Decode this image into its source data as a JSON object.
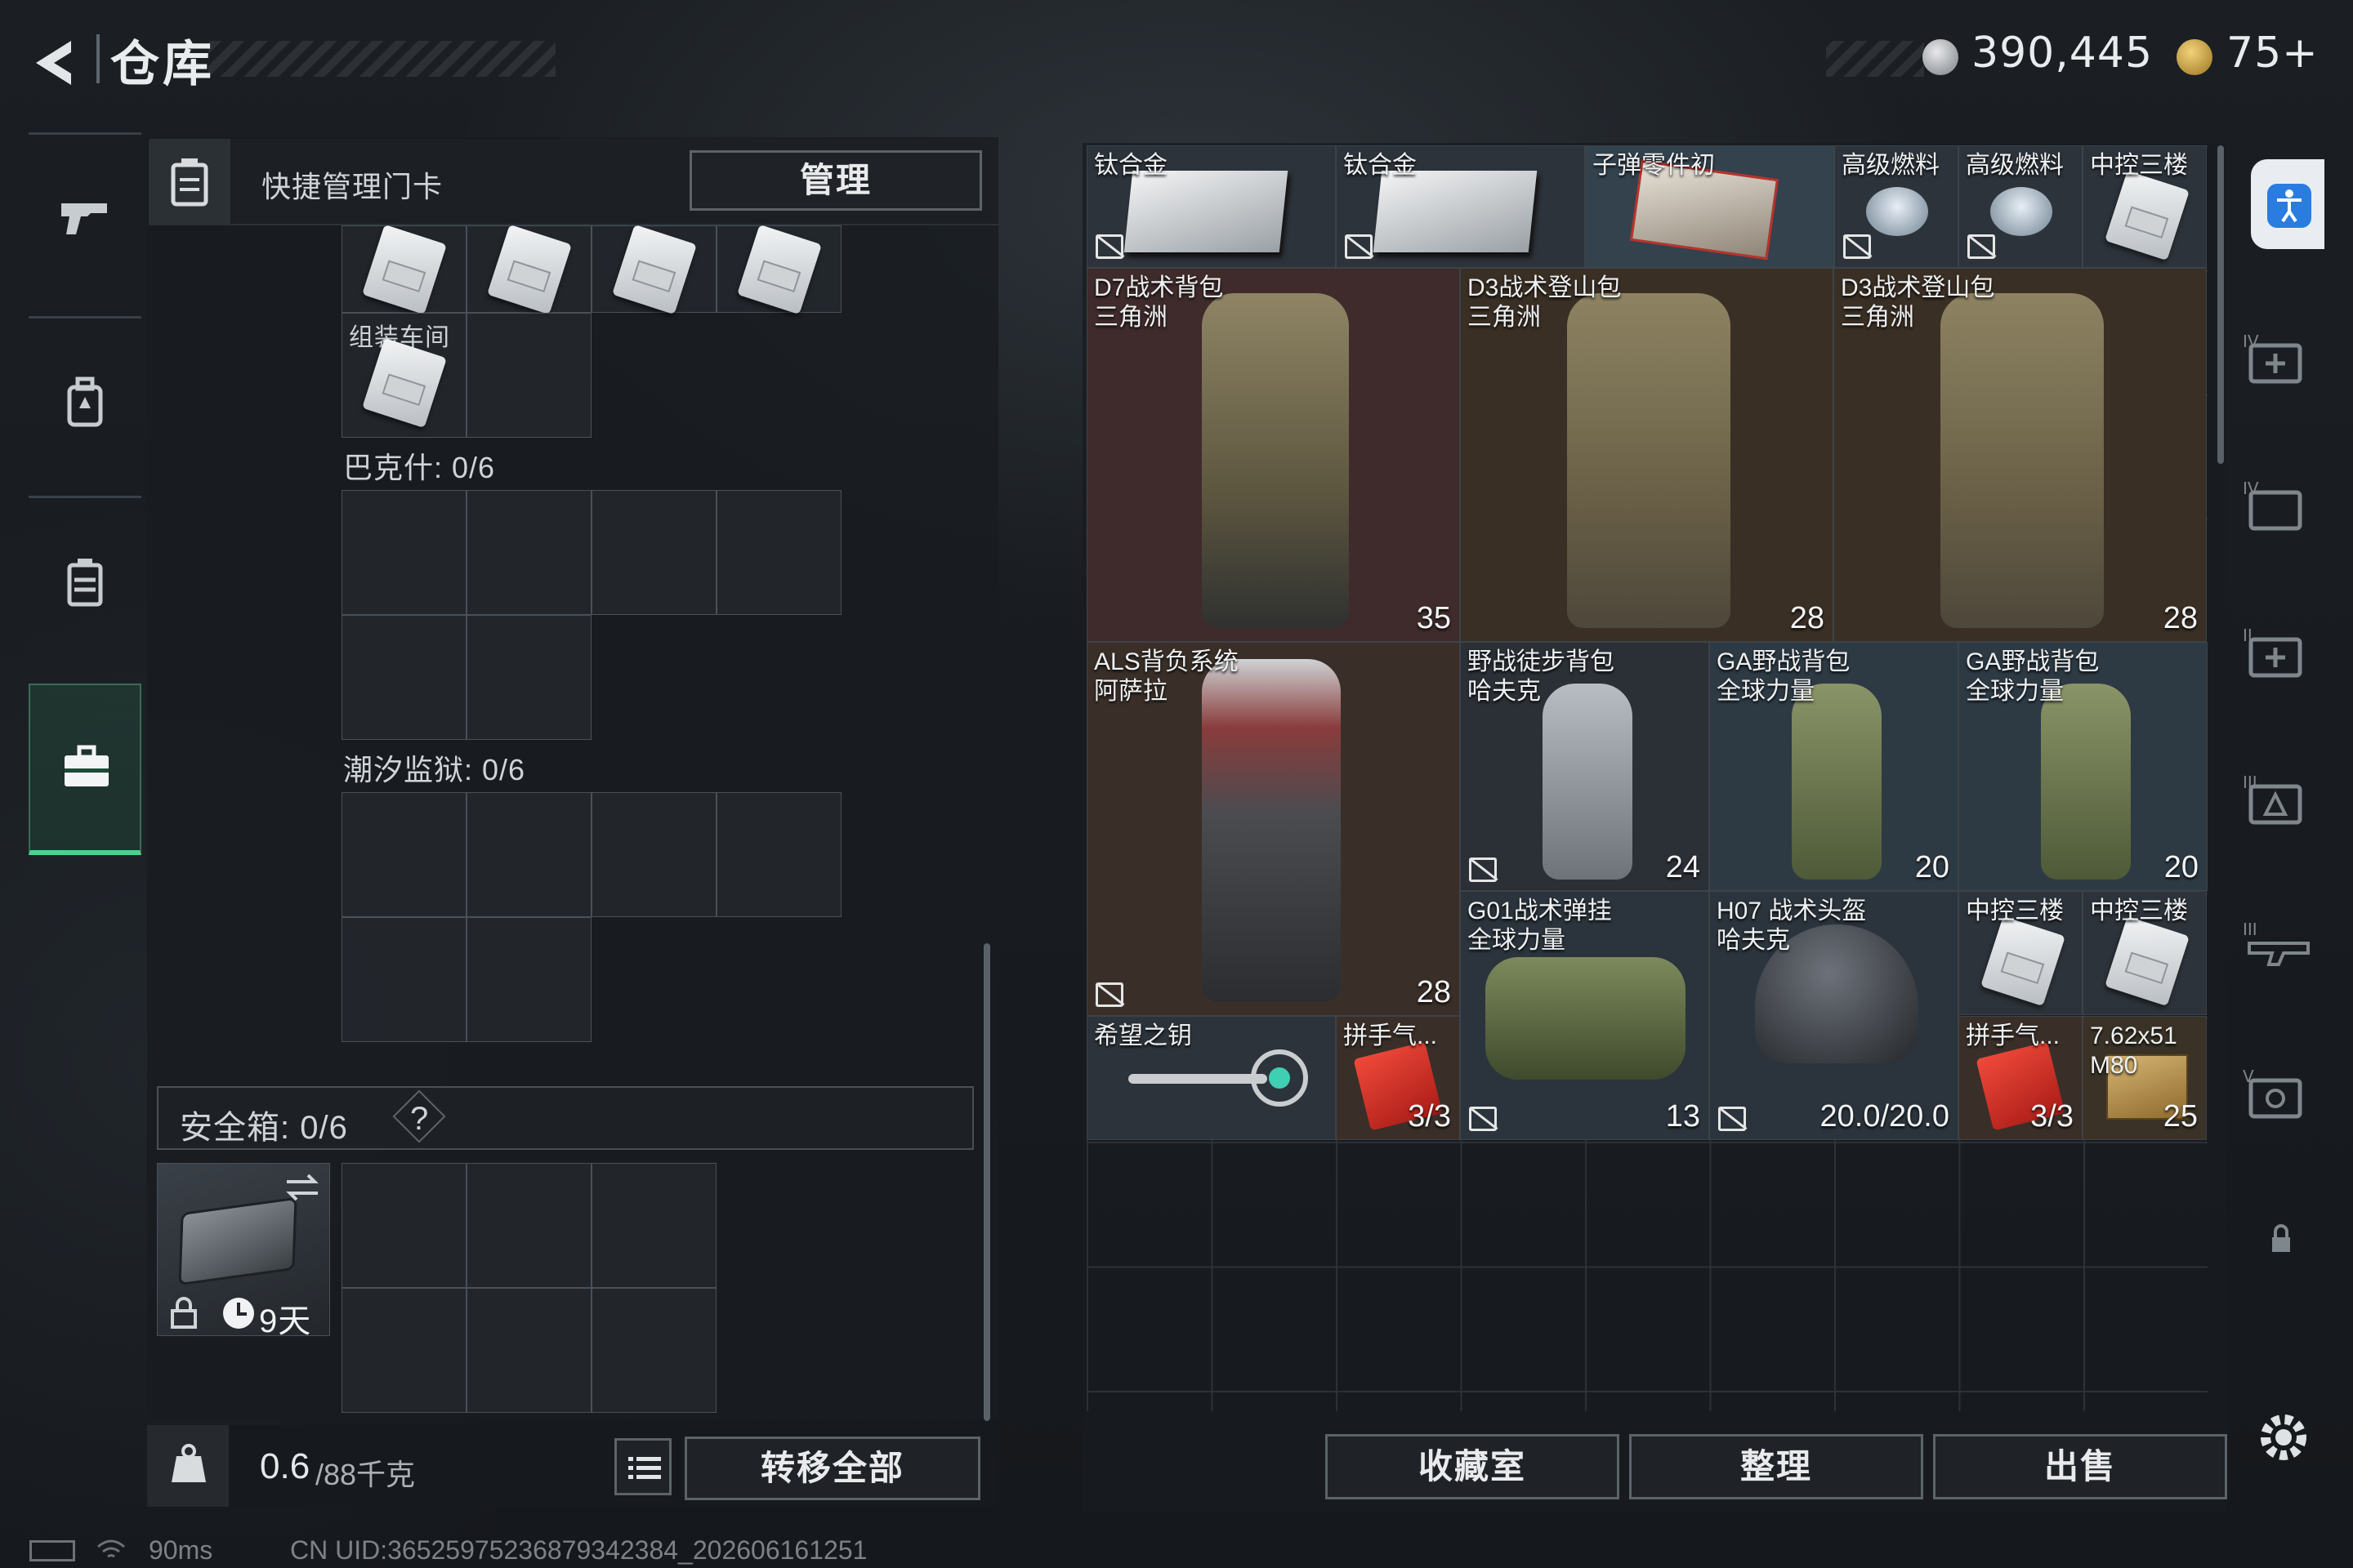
{
  "header": {
    "title": "仓库",
    "money": "390,445",
    "tokens": "75+"
  },
  "left_panel": {
    "keycard_manager_label": "快捷管理门卡",
    "manage_button": "管理",
    "workshop_label": "组装车间",
    "bakesh_label": "巴克什: 0/6",
    "tidal_prison_label": "潮汐监狱: 0/6",
    "safe_box_label": "安全箱:  0/6",
    "safe_box_help": "?",
    "safe_timer": "9天",
    "weight": "0.6",
    "weight_unit": "/88千克",
    "transfer_all_button": "转移全部"
  },
  "items": [
    {
      "name": "钛合金",
      "untradable": true
    },
    {
      "name": "钛合金",
      "untradable": true
    },
    {
      "name": "子弹零件初"
    },
    {
      "name": "高级燃料",
      "untradable": true
    },
    {
      "name": "高级燃料",
      "untradable": true
    },
    {
      "name": "中控三楼"
    },
    {
      "name": "D7战术背包\n三角洲",
      "count": "35"
    },
    {
      "name": "D3战术登山包\n三角洲",
      "count": "28"
    },
    {
      "name": "D3战术登山包\n三角洲",
      "count": "28"
    },
    {
      "name": "ALS背负系统\n阿萨拉",
      "count": "28",
      "untradable": true
    },
    {
      "name": "野战徒步背包\n哈夫克",
      "count": "24",
      "untradable": true
    },
    {
      "name": "GA野战背包\n全球力量",
      "count": "20"
    },
    {
      "name": "GA野战背包\n全球力量",
      "count": "20"
    },
    {
      "name": "G01战术弹挂\n全球力量",
      "count": "13",
      "untradable": true
    },
    {
      "name": "H07 战术头盔\n哈夫克",
      "count": "20.0/20.0",
      "untradable": true
    },
    {
      "name": "中控三楼"
    },
    {
      "name": "中控三楼"
    },
    {
      "name": "希望之钥"
    },
    {
      "name": "拼手气...",
      "count": "3/3"
    },
    {
      "name": "拼手气...",
      "count": "3/3"
    },
    {
      "name": "7.62x51\nM80",
      "count": "25"
    }
  ],
  "bottom_buttons": {
    "collection": "收藏室",
    "organize": "整理",
    "sell": "出售"
  },
  "status_bar": {
    "ping": "90ms",
    "uid": "CN UID:36525975236879342384_202606161251"
  },
  "colors": {
    "accent_green": "#4fd08e",
    "info_blue": "#2a7ce0"
  }
}
